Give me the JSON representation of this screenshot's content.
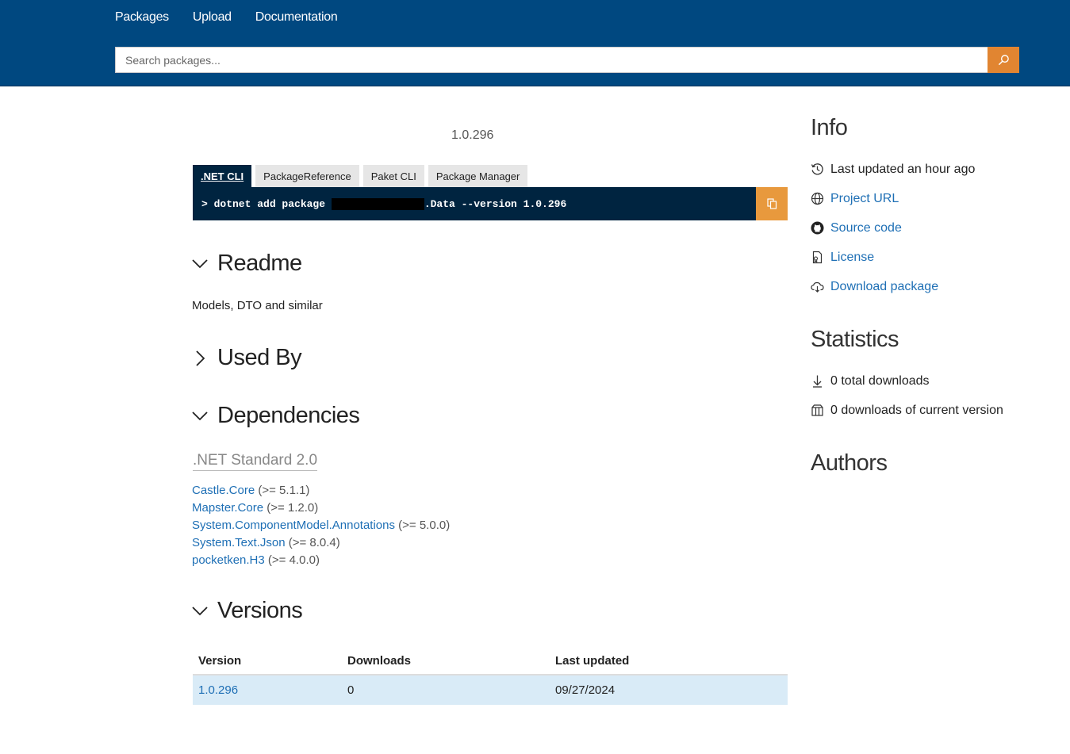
{
  "nav": {
    "packages": "Packages",
    "upload": "Upload",
    "documentation": "Documentation"
  },
  "search": {
    "placeholder": "Search packages..."
  },
  "package": {
    "version": "1.0.296"
  },
  "install": {
    "tabs": [
      ".NET CLI",
      "PackageReference",
      "Paket CLI",
      "Package Manager"
    ],
    "command_prefix": "> dotnet add package ",
    "command_suffix": ".Data --version 1.0.296"
  },
  "readme": {
    "title": "Readme",
    "text": "Models, DTO and similar"
  },
  "used_by": {
    "title": "Used By"
  },
  "dependencies": {
    "title": "Dependencies",
    "framework": ".NET Standard 2.0",
    "items": [
      {
        "name": "Castle.Core",
        "range": "(>= 5.1.1)"
      },
      {
        "name": "Mapster.Core",
        "range": "(>= 1.2.0)"
      },
      {
        "name": "System.ComponentModel.Annotations",
        "range": "(>= 5.0.0)"
      },
      {
        "name": "System.Text.Json",
        "range": "(>= 8.0.4)"
      },
      {
        "name": "pocketken.H3",
        "range": "(>= 4.0.0)"
      }
    ]
  },
  "versions": {
    "title": "Versions",
    "columns": [
      "Version",
      "Downloads",
      "Last updated"
    ],
    "rows": [
      {
        "version": "1.0.296",
        "downloads": "0",
        "updated": "09/27/2024"
      }
    ]
  },
  "info": {
    "title": "Info",
    "last_updated": "Last updated an hour ago",
    "project_url": "Project URL",
    "source_code": "Source code",
    "license": "License",
    "download_package": "Download package"
  },
  "statistics": {
    "title": "Statistics",
    "total_downloads": "0 total downloads",
    "current_downloads": "0 downloads of current version"
  },
  "authors": {
    "title": "Authors"
  },
  "colors": {
    "header": "#004880",
    "accent": "#e18531",
    "cli": "#002440",
    "link": "#1e6fb5"
  }
}
